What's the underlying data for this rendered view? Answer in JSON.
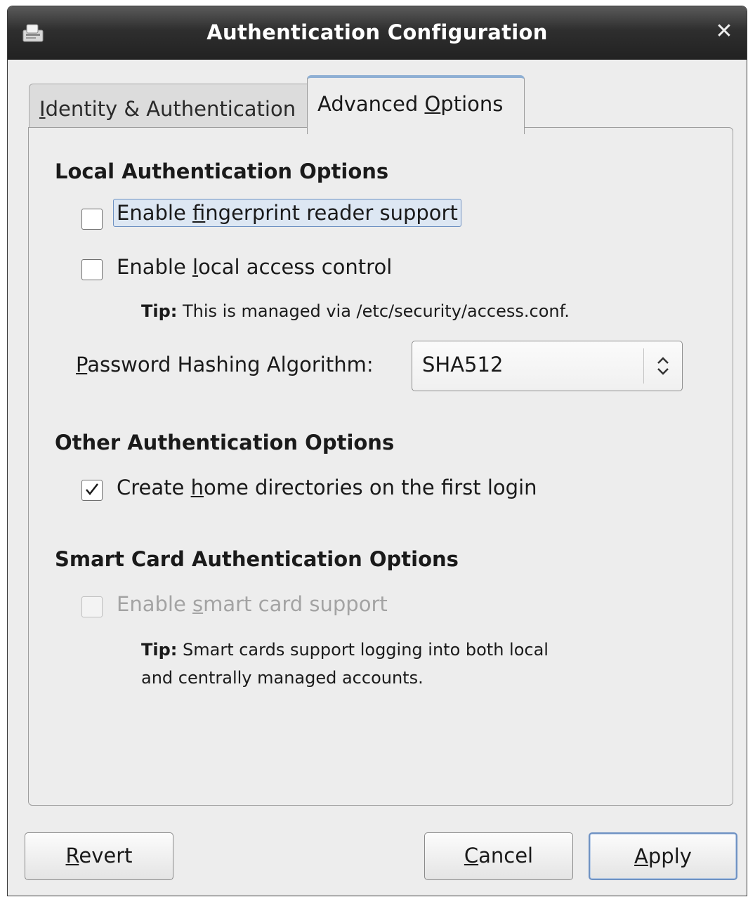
{
  "window": {
    "title": "Authentication Configuration",
    "icons": {
      "app": "authentication-app-icon",
      "close": "close-icon"
    }
  },
  "tabs": [
    {
      "label_pre": "",
      "mnemonic": "I",
      "label_post": "dentity & Authentication",
      "active": false
    },
    {
      "label_pre": "Advanced ",
      "mnemonic": "O",
      "label_post": "ptions",
      "active": true
    }
  ],
  "local": {
    "heading": "Local Authentication Options",
    "fingerprint": {
      "pre": "Enable ",
      "mn": "f",
      "post": "ingerprint reader support",
      "checked": false
    },
    "access": {
      "pre": "Enable ",
      "mn": "l",
      "post": "ocal access control",
      "checked": false
    },
    "tip_bold": "Tip:",
    "tip_text": " This is managed via /etc/security/access.conf.",
    "pw_label_mn": "P",
    "pw_label_post": "assword Hashing Algorithm:",
    "pw_value": "SHA512"
  },
  "other": {
    "heading": "Other Authentication Options",
    "homedir": {
      "pre": "Create ",
      "mn": "h",
      "post": "ome directories on the first login",
      "checked": true
    }
  },
  "smart": {
    "heading": "Smart Card Authentication Options",
    "enable": {
      "pre": "Enable ",
      "mn": "s",
      "post": "mart card support",
      "checked": false,
      "disabled": true
    },
    "tip_bold": "Tip:",
    "tip_line1": " Smart cards support logging into both local",
    "tip_line2": "and centrally managed accounts."
  },
  "buttons": {
    "revert": {
      "mn": "R",
      "post": "evert"
    },
    "cancel": {
      "mn": "C",
      "post": "ancel"
    },
    "apply": {
      "mn": "A",
      "post": "pply"
    }
  },
  "colors": {
    "titlebar": "#2e2e2e",
    "focus": "#6f92c3",
    "tab_highlight": "#8fb0d4"
  }
}
